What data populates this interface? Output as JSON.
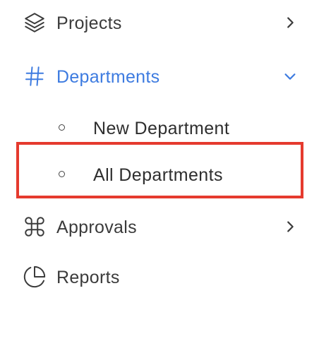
{
  "menu": {
    "projects": {
      "label": "Projects",
      "icon": "layers-icon",
      "chevron": "chevron-right-icon"
    },
    "departments": {
      "label": "Departments",
      "icon": "hash-icon",
      "chevron": "chevron-down-icon",
      "expanded": true,
      "color": "#3d7be0",
      "children": [
        {
          "label": "New Department"
        },
        {
          "label": "All Departments",
          "highlighted": true
        }
      ]
    },
    "approvals": {
      "label": "Approvals",
      "icon": "command-icon",
      "chevron": "chevron-right-icon"
    },
    "reports": {
      "label": "Reports",
      "icon": "pie-chart-icon"
    }
  },
  "highlight_color": "#e53a2e"
}
